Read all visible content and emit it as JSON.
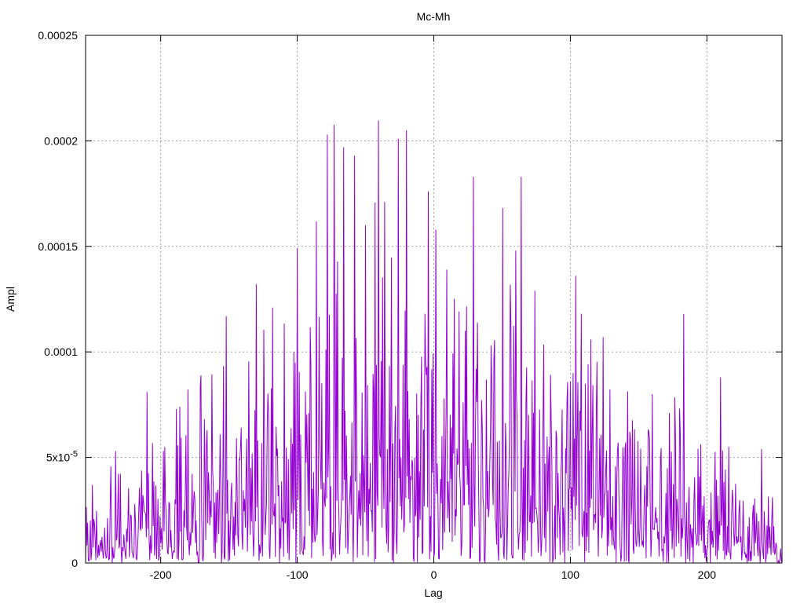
{
  "chart_data": {
    "type": "line",
    "title": "Mc-Mh",
    "xlabel": "Lag",
    "ylabel": "Ampl",
    "xlim": [
      -255,
      255
    ],
    "ylim": [
      0,
      0.00025
    ],
    "grid": true,
    "x_ticks": [
      {
        "value": -200,
        "label": "-200"
      },
      {
        "value": -100,
        "label": "-100"
      },
      {
        "value": 0,
        "label": "0"
      },
      {
        "value": 100,
        "label": "100"
      },
      {
        "value": 200,
        "label": "200"
      }
    ],
    "y_ticks": [
      {
        "value": 0,
        "label": "0",
        "sup": ""
      },
      {
        "value": 5e-05,
        "label": "5x10",
        "sup": "-5"
      },
      {
        "value": 0.0001,
        "label": "0.0001",
        "sup": ""
      },
      {
        "value": 0.00015,
        "label": "0.00015",
        "sup": ""
      },
      {
        "value": 0.0002,
        "label": "0.0002",
        "sup": ""
      },
      {
        "value": 0.00025,
        "label": "0.00025",
        "sup": ""
      }
    ],
    "series": [
      {
        "color": "#9400d3",
        "envelope": [
          [
            -255,
            3e-05
          ],
          [
            -230,
            5e-05
          ],
          [
            -200,
            7e-05
          ],
          [
            -180,
            8e-05
          ],
          [
            -160,
            0.0001
          ],
          [
            -140,
            0.00011
          ],
          [
            -120,
            0.00013
          ],
          [
            -100,
            0.00015
          ],
          [
            -80,
            0.00019
          ],
          [
            -60,
            0.0002
          ],
          [
            -40,
            0.0002
          ],
          [
            -20,
            0.0002
          ],
          [
            0,
            0.00017
          ],
          [
            20,
            0.00016
          ],
          [
            40,
            0.00015
          ],
          [
            60,
            0.00016
          ],
          [
            80,
            0.00013
          ],
          [
            100,
            0.00012
          ],
          [
            120,
            0.00011
          ],
          [
            140,
            0.0001
          ],
          [
            160,
            9e-05
          ],
          [
            180,
            9e-05
          ],
          [
            200,
            7e-05
          ],
          [
            230,
            5e-05
          ],
          [
            255,
            3e-05
          ]
        ],
        "peaks": [
          [
            -250,
            3.7e-05
          ],
          [
            -233,
            5.3e-05
          ],
          [
            -210,
            8.1e-05
          ],
          [
            -186,
            7.4e-05
          ],
          [
            -152,
            0.000117
          ],
          [
            -130,
            0.000132
          ],
          [
            -118,
            0.000121
          ],
          [
            -100,
            0.000149
          ],
          [
            -78,
            0.000203
          ],
          [
            -66,
            0.000197
          ],
          [
            -58,
            0.000193
          ],
          [
            -50,
            0.00016
          ],
          [
            -36,
            0.000171
          ],
          [
            -26,
            0.000201
          ],
          [
            -20,
            0.000205
          ],
          [
            -4,
            0.000176
          ],
          [
            29,
            0.000183
          ],
          [
            64,
            0.000183
          ],
          [
            74,
            0.000129
          ],
          [
            104,
            0.000136
          ],
          [
            124,
            0.000107
          ],
          [
            160,
            8e-05
          ],
          [
            183,
            0.000118
          ],
          [
            210,
            8.8e-05
          ],
          [
            240,
            5.4e-05
          ]
        ],
        "points": []
      }
    ]
  }
}
